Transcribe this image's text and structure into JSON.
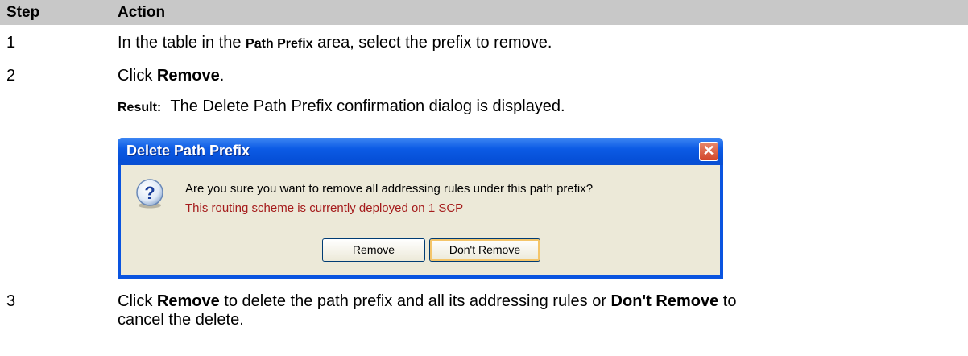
{
  "table": {
    "headers": {
      "step": "Step",
      "action": "Action"
    },
    "rows": [
      {
        "step": "1",
        "pre": "In the table in the ",
        "bold": "Path Prefix",
        "post": " area, select the prefix to remove."
      },
      {
        "step": "2",
        "pre": "Click ",
        "bold": "Remove",
        "post": ".",
        "result_label": "Result:",
        "result_text": "The Delete Path Prefix confirmation dialog is displayed."
      },
      {
        "step": "3",
        "line1_pre": "Click ",
        "line1_bold1": "Remove",
        "line1_mid": " to delete the path prefix and all its addressing rules or ",
        "line1_bold2": "Don't Remove",
        "line1_post": " to",
        "line2": "cancel the delete."
      }
    ]
  },
  "dialog": {
    "title": "Delete Path Prefix",
    "close_symbol": "✕",
    "icon": "question-icon",
    "message": "Are you sure you want to remove all addressing rules under this path prefix?",
    "warning": "This routing scheme is currently deployed on 1 SCP",
    "warning_color": "#a51c1c",
    "buttons": {
      "remove": "Remove",
      "dont_remove": "Don't Remove"
    }
  }
}
